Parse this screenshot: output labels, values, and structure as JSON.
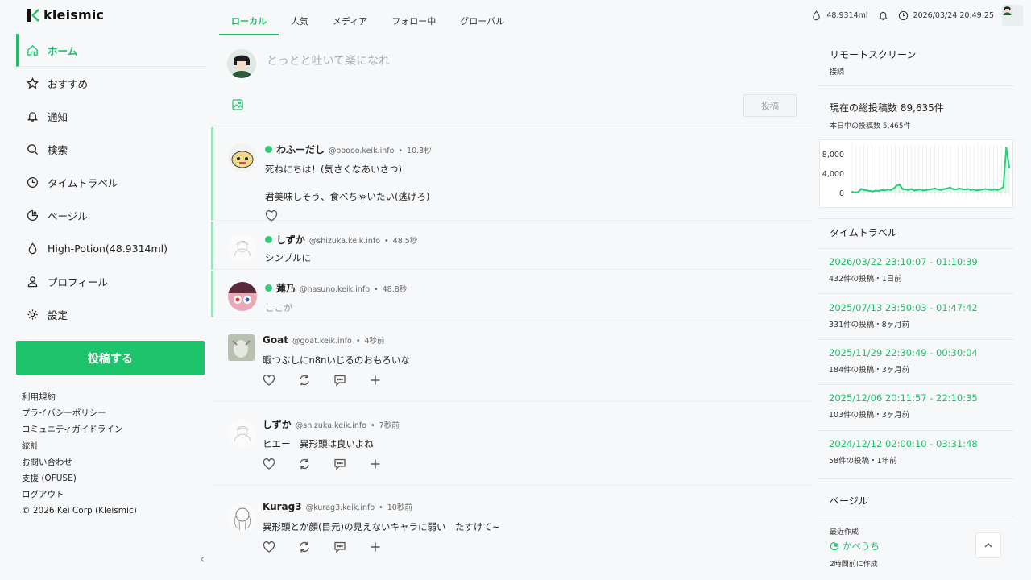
{
  "app": {
    "logo": "kleismic"
  },
  "sidebar": {
    "items": [
      {
        "label": "ホーム",
        "icon": "home-icon"
      },
      {
        "label": "おすすめ",
        "icon": "star-icon"
      },
      {
        "label": "通知",
        "icon": "bell-icon"
      },
      {
        "label": "検索",
        "icon": "search-icon"
      },
      {
        "label": "タイムトラベル",
        "icon": "clock-icon"
      },
      {
        "label": "ページル",
        "icon": "page-icon"
      },
      {
        "label": "High-Potion(48.9314ml)",
        "icon": "drop-icon"
      },
      {
        "label": "プロフィール",
        "icon": "user-icon"
      },
      {
        "label": "設定",
        "icon": "gear-icon"
      }
    ],
    "post_button": "投稿する",
    "footer": [
      "利用規約",
      "プライバシーポリシー",
      "コミュニティガイドライン",
      "統計",
      "お問い合わせ",
      "支援 (OFUSE)",
      "ログアウト",
      "© 2026 Kei Corp (Kleismic)"
    ]
  },
  "tabs": [
    "ローカル",
    "人気",
    "メディア",
    "フォロー中",
    "グローバル"
  ],
  "composer": {
    "placeholder": "とっとと吐いて楽になれ",
    "submit": "投稿"
  },
  "posts": [
    {
      "name": "わふーだし",
      "handle": "@ooooo.keik.info",
      "time": "10.3秒",
      "lines": [
        "死ねにちは！(気さくなあいさつ)",
        "君美味しそう、食べちゃいたい(逃げろ)"
      ]
    },
    {
      "name": "しずか",
      "handle": "@shizuka.keik.info",
      "time": "48.5秒",
      "lines": [
        "シンプルに"
      ]
    },
    {
      "name": "蓮乃",
      "handle": "@hasuno.keik.info",
      "time": "48.8秒",
      "lines": [
        "ここが"
      ]
    },
    {
      "name": "Goat",
      "handle": "@goat.keik.info",
      "time": "4秒前",
      "lines": [
        "暇つぶしにn8nいじるのおもろいな"
      ]
    },
    {
      "name": "しずか",
      "handle": "@shizuka.keik.info",
      "time": "7秒前",
      "lines": [
        "ヒエー　異形頭は良いよね"
      ]
    },
    {
      "name": "Kurag3",
      "handle": "@kurag3.keik.info",
      "time": "10秒前",
      "lines": [
        "異形頭とか顔(目元)の見えないキャラに弱い　たすけて~"
      ]
    }
  ],
  "topbar": {
    "potion": "48.9314ml",
    "datetime": "2026/03/24 20:49:25"
  },
  "remote": {
    "title": "リモートスクリーン",
    "status": "接続"
  },
  "stats": {
    "title": "現在の総投稿数 89,635件",
    "today": "本日中の投稿数 5,465件"
  },
  "chart_data": {
    "type": "area",
    "y_ticks": [
      "8,000",
      "4,000",
      "0"
    ],
    "ylim": [
      0,
      10000
    ],
    "values": [
      300,
      200,
      250,
      900,
      700,
      600,
      500,
      400,
      600,
      500,
      700,
      600,
      800,
      700,
      1000,
      1600,
      1800,
      900,
      800,
      700,
      900,
      600,
      700,
      800,
      600,
      700,
      800,
      900,
      1000,
      800,
      700,
      900,
      1000,
      1200,
      900,
      800,
      1000,
      900,
      800,
      900,
      700,
      800,
      600,
      700,
      800,
      900,
      800,
      700,
      800,
      700,
      900,
      1300,
      9400,
      5400
    ],
    "color": "#2ecc7a"
  },
  "timetravel": {
    "title": "タイムトラベル",
    "entries": [
      {
        "range": "2026/03/22 23:10:07 - 01:10:39",
        "meta": "432件の投稿・1日前"
      },
      {
        "range": "2025/07/13 23:50:03 - 01:47:42",
        "meta": "331件の投稿・8ヶ月前"
      },
      {
        "range": "2025/11/29 22:30:49 - 00:30:04",
        "meta": "184件の投稿・3ヶ月前"
      },
      {
        "range": "2025/12/06 20:11:57 - 22:10:35",
        "meta": "103件の投稿・3ヶ月前"
      },
      {
        "range": "2024/12/12 02:00:10 - 03:31:48",
        "meta": "58件の投稿・1年前"
      }
    ]
  },
  "pagel": {
    "title": "ページル",
    "recent_label": "最近作成",
    "item": "かべうち",
    "item_time": "2時間前に作成"
  }
}
